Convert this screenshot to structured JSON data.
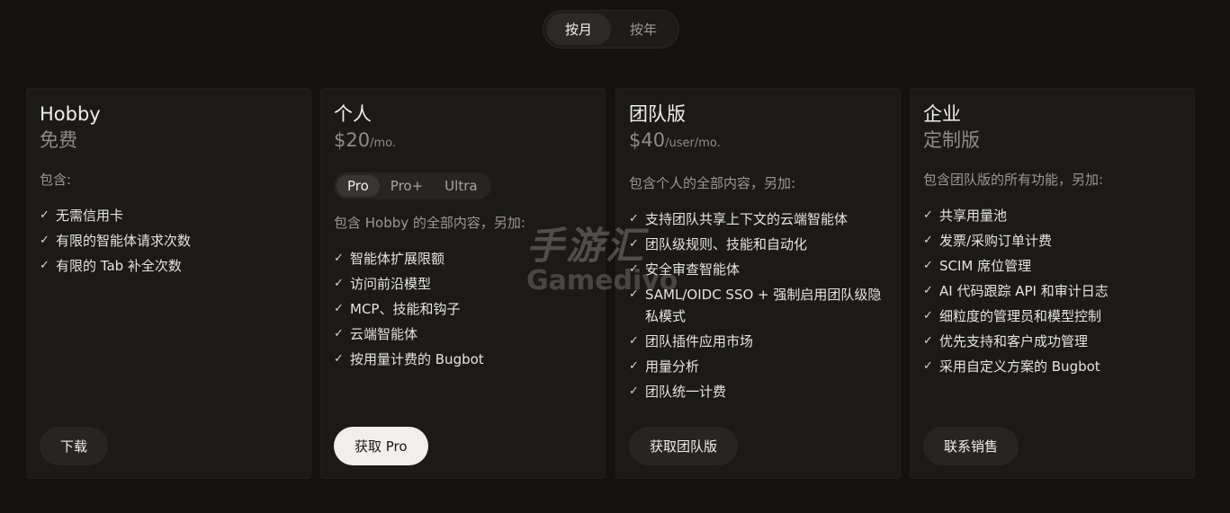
{
  "toggle": {
    "monthly": "按月",
    "yearly": "按年",
    "selected": "monthly"
  },
  "plans": [
    {
      "name": "Hobby",
      "price": "免费",
      "price_unit": "",
      "includes": "包含:",
      "features": [
        "无需信用卡",
        "有限的智能体请求次数",
        "有限的 Tab 补全次数"
      ],
      "cta": "下载"
    },
    {
      "name": "个人",
      "price": "$20",
      "price_unit": "/mo.",
      "tiers": [
        "Pro",
        "Pro+",
        "Ultra"
      ],
      "selected_tier": "Pro",
      "includes": "包含 Hobby 的全部内容，另加:",
      "features": [
        "智能体扩展限额",
        "访问前沿模型",
        "MCP、技能和钩子",
        "云端智能体",
        "按用量计费的 Bugbot"
      ],
      "cta": "获取 Pro"
    },
    {
      "name": "团队版",
      "price": "$40",
      "price_unit": "/user/mo.",
      "includes": "包含个人的全部内容，另加:",
      "features": [
        "支持团队共享上下文的云端智能体",
        "团队级规则、技能和自动化",
        "安全审查智能体",
        "SAML/OIDC SSO + 强制启用团队级隐私模式",
        "团队插件应用市场",
        "用量分析",
        "团队统一计费"
      ],
      "cta": "获取团队版"
    },
    {
      "name": "企业",
      "price": "定制版",
      "price_unit": "",
      "includes": "包含团队版的所有功能，另加:",
      "features": [
        "共享用量池",
        "发票/采购订单计费",
        "SCIM 席位管理",
        "AI 代码跟踪 API 和审计日志",
        "细粒度的管理员和模型控制",
        "优先支持和客户成功管理",
        "采用自定义方案的 Bugbot"
      ],
      "cta": "联系销售"
    }
  ],
  "watermark": {
    "cn": "手游汇",
    "en": "Gamedivo"
  },
  "icons": {
    "check": "check-icon"
  },
  "colors": {
    "background": "#14120f",
    "card": "#1b1a18",
    "primary_button": "#f1efec"
  }
}
